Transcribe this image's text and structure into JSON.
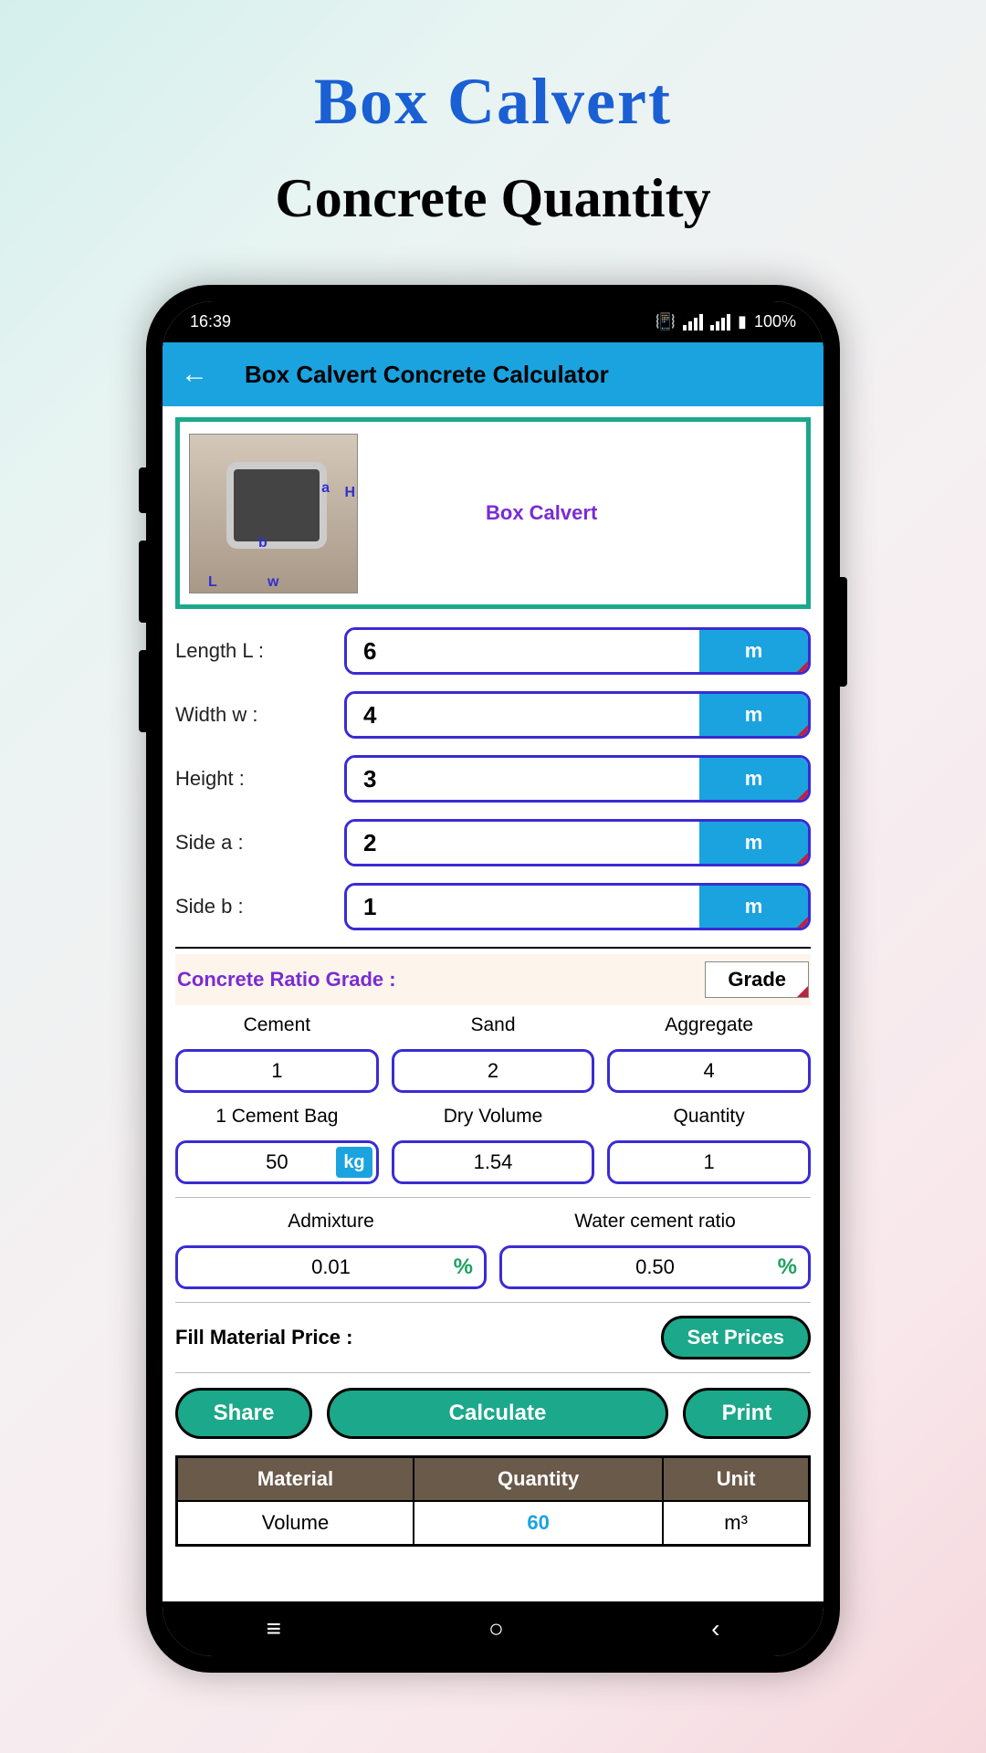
{
  "page": {
    "title": "Box Calvert",
    "subtitle": "Concrete Quantity"
  },
  "status": {
    "time": "16:39",
    "battery": "100%"
  },
  "app": {
    "title": "Box Calvert Concrete Calculator"
  },
  "illustration": {
    "title": "Box Calvert",
    "dims": {
      "L": "L",
      "w": "w",
      "H": "H",
      "a": "a",
      "b": "b"
    }
  },
  "inputs": {
    "length": {
      "label": "Length L :",
      "value": "6",
      "unit": "m"
    },
    "width": {
      "label": "Width w :",
      "value": "4",
      "unit": "m"
    },
    "height": {
      "label": "Height  :",
      "value": "3",
      "unit": "m"
    },
    "side_a": {
      "label": "Side a :",
      "value": "2",
      "unit": "m"
    },
    "side_b": {
      "label": "Side b :",
      "value": "1",
      "unit": "m"
    }
  },
  "ratio": {
    "label": "Concrete Ratio Grade :",
    "grade_btn": "Grade",
    "cement_label": "Cement",
    "sand_label": "Sand",
    "aggregate_label": "Aggregate",
    "cement": "1",
    "sand": "2",
    "aggregate": "4",
    "bag_label": "1 Cement Bag",
    "dry_label": "Dry Volume",
    "qty_label": "Quantity",
    "bag": "50",
    "bag_unit": "kg",
    "dry": "1.54",
    "qty": "1",
    "admix_label": "Admixture",
    "wcr_label": "Water cement ratio",
    "admix": "0.01",
    "wcr": "0.50",
    "pct": "%"
  },
  "price": {
    "label": "Fill Material Price :",
    "btn": "Set Prices"
  },
  "actions": {
    "share": "Share",
    "calculate": "Calculate",
    "print": "Print"
  },
  "results": {
    "headers": {
      "material": "Material",
      "quantity": "Quantity",
      "unit": "Unit"
    },
    "row": {
      "material": "Volume",
      "quantity": "60",
      "unit": "m³"
    }
  }
}
